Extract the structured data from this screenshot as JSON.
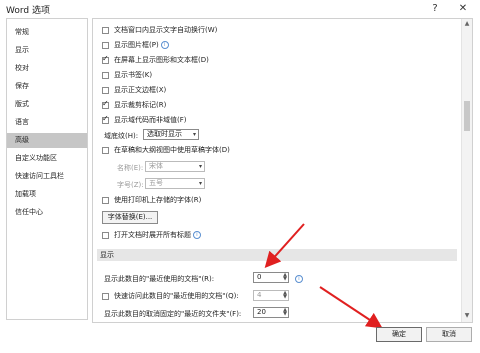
{
  "window": {
    "title": "Word 选项",
    "help": "?",
    "close": "✕"
  },
  "sidebar": {
    "items": [
      {
        "label": "常规"
      },
      {
        "label": "显示"
      },
      {
        "label": "校对"
      },
      {
        "label": "保存"
      },
      {
        "label": "版式"
      },
      {
        "label": "语言"
      },
      {
        "label": "高级"
      },
      {
        "label": "自定义功能区"
      },
      {
        "label": "快速访问工具栏"
      },
      {
        "label": "加载项"
      },
      {
        "label": "信任中心"
      }
    ],
    "selected": "高级"
  },
  "options": [
    {
      "label": "文档窗口内显示文字自动换行(W)",
      "checked": false
    },
    {
      "label": "显示图片框(P)",
      "checked": false,
      "info": true
    },
    {
      "label": "在屏幕上显示图形和文本框(D)",
      "checked": true
    },
    {
      "label": "显示书签(K)",
      "checked": false
    },
    {
      "label": "显示正文边框(X)",
      "checked": false
    },
    {
      "label": "显示裁剪标记(R)",
      "checked": true
    },
    {
      "label": "显示域代码而非域值(F)",
      "checked": true
    }
  ],
  "field_shading": {
    "label": "域底纹(H):",
    "value": "选取时显示"
  },
  "draft_font": {
    "label": "在草稿和大纲视图中使用草稿字体(D)",
    "checked": false
  },
  "name": {
    "label": "名称(E):",
    "value": "宋体"
  },
  "size": {
    "label": "字号(Z):",
    "value": "五号"
  },
  "printer_font": {
    "label": "使用打印机上存储的字体(R)",
    "checked": false
  },
  "font_subst_button": "字体替换(E)...",
  "expand_headings": {
    "label": "打开文档时展开所有标题",
    "checked": false
  },
  "display_section": {
    "title": "显示"
  },
  "recent_docs": {
    "label": "显示此数目的\"最近使用的文档\"(R):",
    "value": "0"
  },
  "quick_access": {
    "label": "快速访问此数目的\"最近使用的文档\"(Q):",
    "value": "4",
    "checked": false
  },
  "recent_folders": {
    "label": "显示此数目的取消固定的\"最近的文件夹\"(F):",
    "value": "20"
  },
  "footer": {
    "ok": "确定",
    "cancel": "取消"
  },
  "colors": {
    "accent_red": "#e02020",
    "sidebar_selected": "#c6c6c6"
  }
}
